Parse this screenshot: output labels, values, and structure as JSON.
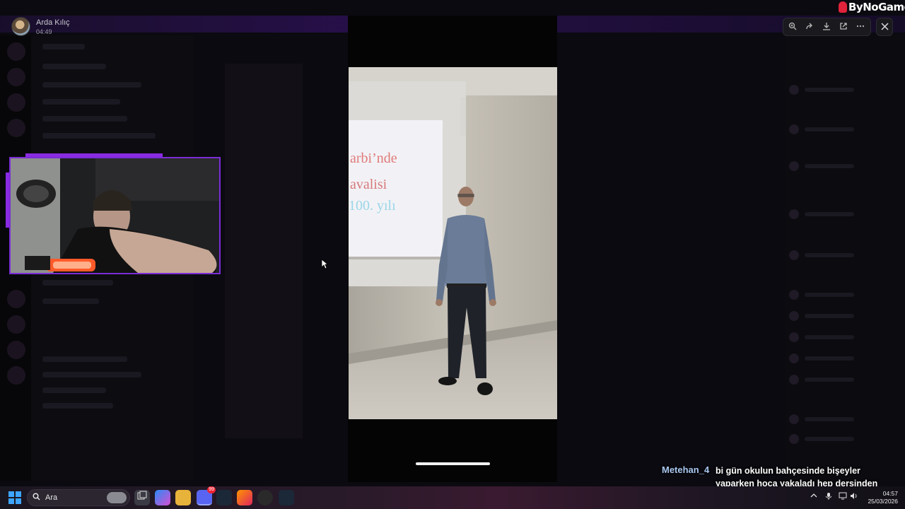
{
  "sender": {
    "name": "Arda Kılıç",
    "time": "04:49"
  },
  "toolbar": {
    "zoom_icon": "zoom-in-icon",
    "forward_icon": "forward-icon",
    "download_icon": "download-icon",
    "open_icon": "open-external-icon",
    "more_icon": "more-icon",
    "close_icon": "close-icon"
  },
  "watermark": {
    "text": "ByNoGame"
  },
  "photo": {
    "slide_line1": "arbi’nde",
    "slide_line2": "avalisi",
    "slide_line3": "100. yılı"
  },
  "chat": {
    "username": "Metehan_4",
    "message": "bi gün okulun bahçesinde bişeyler yaparken hoca yakaladı hep dersinden kaldım"
  },
  "taskbar": {
    "search_placeholder": "Ara",
    "clock_time": "04:57",
    "clock_date": "25/03/2026",
    "discord_badge": "99"
  },
  "colors": {
    "accent": "#7b2cd6",
    "chat_user": "#a9c8f0",
    "watermark_red": "#e0223a"
  }
}
